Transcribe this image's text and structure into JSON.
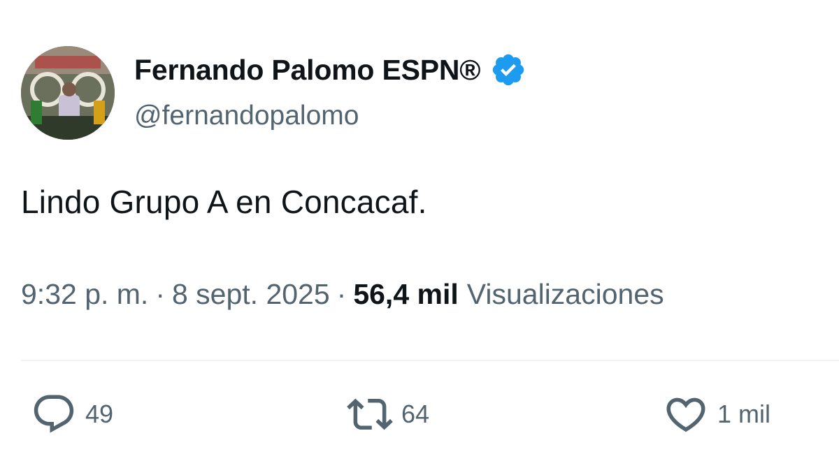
{
  "author": {
    "display_name": "Fernando Palomo ESPN®",
    "handle": "@fernandopalomo",
    "verified": true,
    "verified_color": "#1d9bf0"
  },
  "tweet": {
    "text": "Lindo Grupo A en Concacaf.",
    "time": "9:32 p. m.",
    "separator": "·",
    "date": "8 sept. 2025",
    "views_count": "56,4 mil",
    "views_label": "Visualizaciones"
  },
  "actions": {
    "reply": {
      "icon": "reply-icon",
      "count": "49"
    },
    "retweet": {
      "icon": "retweet-icon",
      "count": "64"
    },
    "like": {
      "icon": "heart-icon",
      "count": "1 mil"
    }
  },
  "colors": {
    "text_primary": "#0f1419",
    "text_secondary": "#536471",
    "divider": "#eff3f4"
  }
}
